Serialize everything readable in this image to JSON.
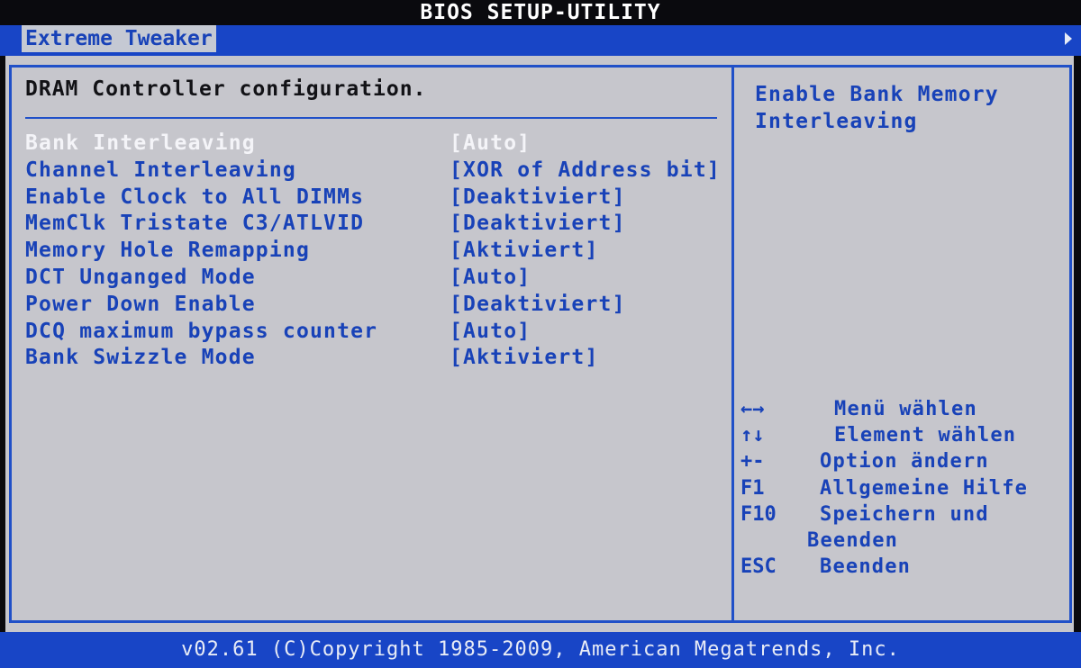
{
  "window": {
    "title": "BIOS SETUP-UTILITY"
  },
  "tabs": {
    "active_label": "Extreme Tweaker"
  },
  "section": {
    "title": "DRAM Controller configuration."
  },
  "settings": [
    {
      "label": "Bank Interleaving",
      "value": "[Auto]"
    },
    {
      "label": "Channel Interleaving",
      "value": "[XOR of Address bit]"
    },
    {
      "label": "Enable Clock to All DIMMs",
      "value": "[Deaktiviert]"
    },
    {
      "label": "MemClk Tristate C3/ATLVID",
      "value": "[Deaktiviert]"
    },
    {
      "label": "Memory Hole Remapping",
      "value": "[Aktiviert]"
    },
    {
      "label": "DCT Unganged Mode",
      "value": "[Auto]"
    },
    {
      "label": "Power Down Enable",
      "value": "[Deaktiviert]"
    },
    {
      "label": "DCQ maximum bypass counter",
      "value": "[Auto]"
    },
    {
      "label": "Bank Swizzle Mode",
      "value": "[Aktiviert]"
    }
  ],
  "help": {
    "text": "Enable Bank Memory Interleaving"
  },
  "keys": [
    {
      "key": "←→",
      "desc": "Menü wählen"
    },
    {
      "key": "↑↓",
      "desc": "Element wählen"
    },
    {
      "key": "+-",
      "desc": "Option ändern"
    },
    {
      "key": "F1",
      "desc": "Allgemeine Hilfe"
    },
    {
      "key": "F10",
      "desc": "Speichern und"
    },
    {
      "key": "",
      "desc": "Beenden"
    },
    {
      "key": "ESC",
      "desc": "Beenden"
    }
  ],
  "footer": {
    "text": "v02.61 (C)Copyright 1985-2009, American Megatrends, Inc."
  },
  "colors": {
    "bar_blue": "#1845c6",
    "panel_gray": "#c6c6cc",
    "text_blue": "#1842b8",
    "selected_text": "#f4f4f8",
    "heading_text": "#121216"
  }
}
